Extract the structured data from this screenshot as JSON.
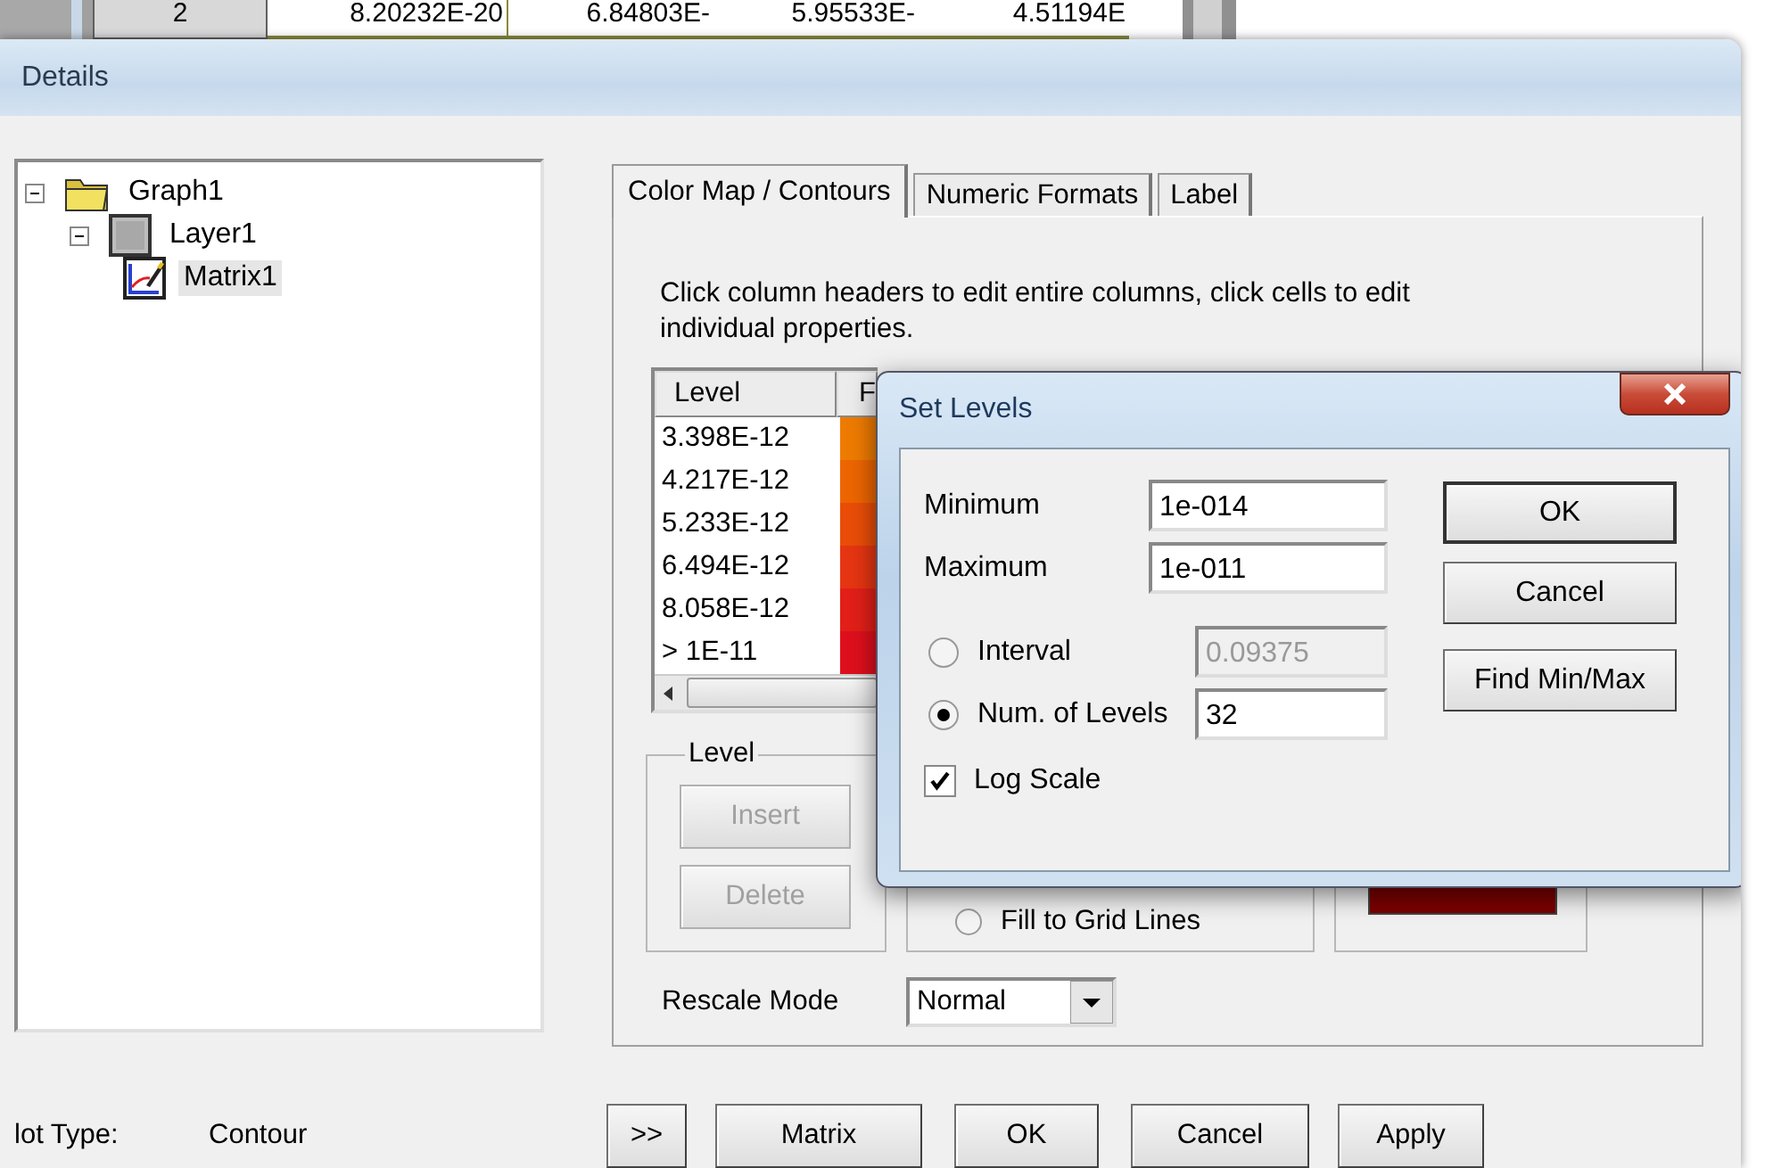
{
  "worksheet": {
    "row_header": "2",
    "cells": [
      "8.20232E-20",
      "6.84803E-",
      "5.95533E-",
      "4.51194E"
    ]
  },
  "window": {
    "title": "Details"
  },
  "tree": [
    {
      "label": "Graph1",
      "kind": "folder",
      "expanded": true,
      "selected": false,
      "children": [
        {
          "label": "Layer1",
          "kind": "layer",
          "expanded": true,
          "selected": false,
          "children": [
            {
              "label": "Matrix1",
              "kind": "plot",
              "selected": true
            }
          ]
        }
      ]
    }
  ],
  "tabs": [
    {
      "label": "Color Map / Contours",
      "selected": true
    },
    {
      "label": "Numeric Formats",
      "selected": false
    },
    {
      "label": "Label",
      "selected": false
    }
  ],
  "instructions": "Click column headers to edit entire columns, click cells to edit individual properties.",
  "level_table": {
    "columns": [
      "Level",
      "F"
    ],
    "rows": [
      {
        "level": "3.398E-12",
        "color": "#ee7b00"
      },
      {
        "level": "4.217E-12",
        "color": "#ec6500"
      },
      {
        "level": "5.233E-12",
        "color": "#e94d08"
      },
      {
        "level": "6.494E-12",
        "color": "#e63512"
      },
      {
        "level": "8.058E-12",
        "color": "#e21f18"
      },
      {
        "level": "> 1E-11",
        "color": "#de0f1c"
      }
    ]
  },
  "level_group": {
    "title": "Level",
    "buttons": [
      {
        "label": "Insert",
        "disabled": true
      },
      {
        "label": "Delete",
        "disabled": true
      }
    ]
  },
  "fill_option": {
    "label": "Fill to Grid Lines",
    "selected": false
  },
  "rescale_mode": {
    "label": "Rescale Mode",
    "value": "Normal"
  },
  "plot_type": {
    "label": "lot Type:",
    "value": "Contour"
  },
  "buttons": [
    ">>",
    "Matrix",
    "OK",
    "Cancel",
    "Apply"
  ],
  "set_levels": {
    "title": "Set Levels",
    "minimum": {
      "label": "Minimum",
      "value": "1e-014"
    },
    "maximum": {
      "label": "Maximum",
      "value": "1e-011"
    },
    "mode_options": [
      {
        "label": "Interval",
        "value": "0.09375",
        "selected": false,
        "disabled": true
      },
      {
        "label": "Num. of Levels",
        "value": "32",
        "selected": true,
        "disabled": false
      }
    ],
    "log_scale": {
      "label": "Log Scale",
      "checked": true
    },
    "buttons": [
      {
        "label": "OK",
        "default": true
      },
      {
        "label": "Cancel",
        "default": false
      },
      {
        "label": "Find Min/Max",
        "default": false
      }
    ]
  }
}
